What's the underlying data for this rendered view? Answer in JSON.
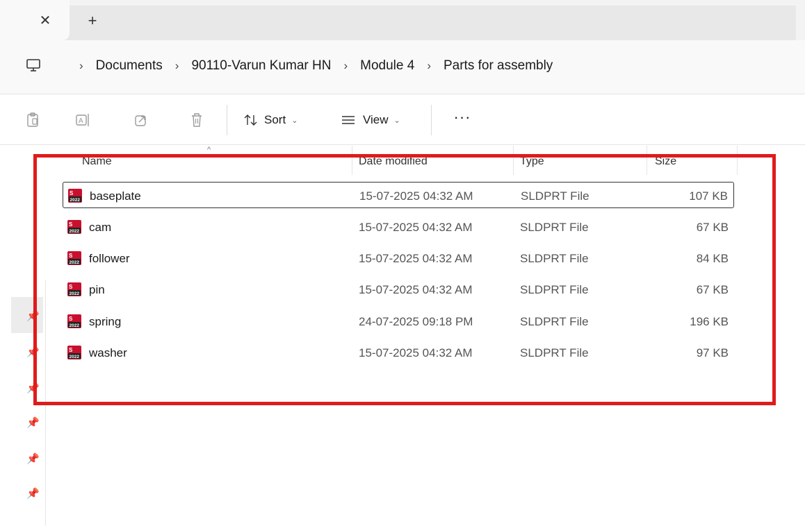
{
  "tabbar": {
    "close_label": "✕",
    "new_tab_label": "+"
  },
  "breadcrumb": {
    "items": [
      "Documents",
      "90110-Varun Kumar HN",
      "Module 4",
      "Parts for assembly"
    ],
    "separator": "›"
  },
  "commandbar": {
    "sort_label": "Sort",
    "view_label": "View",
    "more_label": "···"
  },
  "columns": {
    "name": "Name",
    "date": "Date modified",
    "type": "Type",
    "size": "Size"
  },
  "files": [
    {
      "name": "baseplate",
      "date": "15-07-2025 04:32 AM",
      "type": "SLDPRT File",
      "size": "107 KB",
      "selected": true
    },
    {
      "name": "cam",
      "date": "15-07-2025 04:32 AM",
      "type": "SLDPRT File",
      "size": "67 KB",
      "selected": false
    },
    {
      "name": "follower",
      "date": "15-07-2025 04:32 AM",
      "type": "SLDPRT File",
      "size": "84 KB",
      "selected": false
    },
    {
      "name": "pin",
      "date": "15-07-2025 04:32 AM",
      "type": "SLDPRT File",
      "size": "67 KB",
      "selected": false
    },
    {
      "name": "spring",
      "date": "24-07-2025 09:18 PM",
      "type": "SLDPRT File",
      "size": "196 KB",
      "selected": false
    },
    {
      "name": "washer",
      "date": "15-07-2025 04:32 AM",
      "type": "SLDPRT File",
      "size": "97 KB",
      "selected": false
    }
  ],
  "file_icon": {
    "name": "solidworks-part-icon",
    "badge": "2022"
  },
  "colors": {
    "highlight": "#e01b1b",
    "icon_red": "#c8102e"
  }
}
